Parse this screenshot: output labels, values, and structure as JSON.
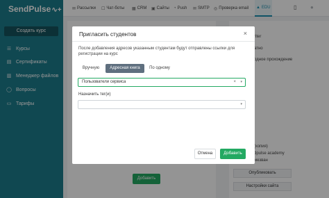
{
  "app": {
    "logo": "SendPulse",
    "logo_mark": "∿+"
  },
  "sidebar": {
    "create_button": "Создать курс",
    "items": [
      {
        "label": "Курсы",
        "icon": "courses-icon",
        "glyph": "☰"
      },
      {
        "label": "Сертификаты",
        "icon": "certificate-icon",
        "glyph": "▤"
      },
      {
        "label": "Менеджер файлов",
        "icon": "file-manager-icon",
        "glyph": "▥"
      },
      {
        "label": "Вопросы",
        "icon": "questions-icon",
        "glyph": "◯"
      },
      {
        "label": "Тарифы",
        "icon": "tariffs-icon",
        "glyph": "▭"
      }
    ]
  },
  "topnav": {
    "items": [
      {
        "label": "Рассылки",
        "icon": "mail-icon",
        "glyph": "✉"
      },
      {
        "label": "Чат-боты",
        "icon": "chatbot-icon",
        "glyph": "☐"
      },
      {
        "label": "CRM",
        "icon": "crm-icon",
        "glyph": "▦"
      },
      {
        "label": "Сайты",
        "icon": "sites-icon",
        "glyph": "▣"
      },
      {
        "label": "Push",
        "icon": "push-icon",
        "glyph": "◔"
      },
      {
        "label": "SMTP",
        "icon": "smtp-icon",
        "glyph": "✉"
      },
      {
        "label": "Проверка email",
        "icon": "email-check-icon",
        "glyph": "◎"
      },
      {
        "label": "EDU",
        "icon": "edu-icon",
        "glyph": "▲"
      }
    ],
    "phone_icon": "▯",
    "avatar_icon": "●"
  },
  "right_panel": {
    "texts": [
      "riter",
      "атно",
      "одное прохождение",
      "(копия)",
      "dpulse academy",
      "мезван"
    ],
    "publish_button": "Опубликовать",
    "site_settings_button": "Настройки сайта"
  },
  "background": {
    "add_button": "Добавить"
  },
  "modal": {
    "title": "Пригласить студентов",
    "close": "×",
    "description": "После добавления адресов указанным студентам будут отправлены ссылки для регистрации на курс",
    "tabs": [
      {
        "label": "Вручную"
      },
      {
        "label": "Адресная книга"
      },
      {
        "label": "По одному"
      }
    ],
    "active_tab": "Адресная книга",
    "address_book": {
      "value": "Пользователи сервиса",
      "clear": "×",
      "caret": "▾"
    },
    "tag_label": "Назначить тег(и)",
    "tag_field": {
      "value": "",
      "caret": "▾"
    },
    "cancel_button": "Отмена",
    "add_button": "Добавить"
  }
}
